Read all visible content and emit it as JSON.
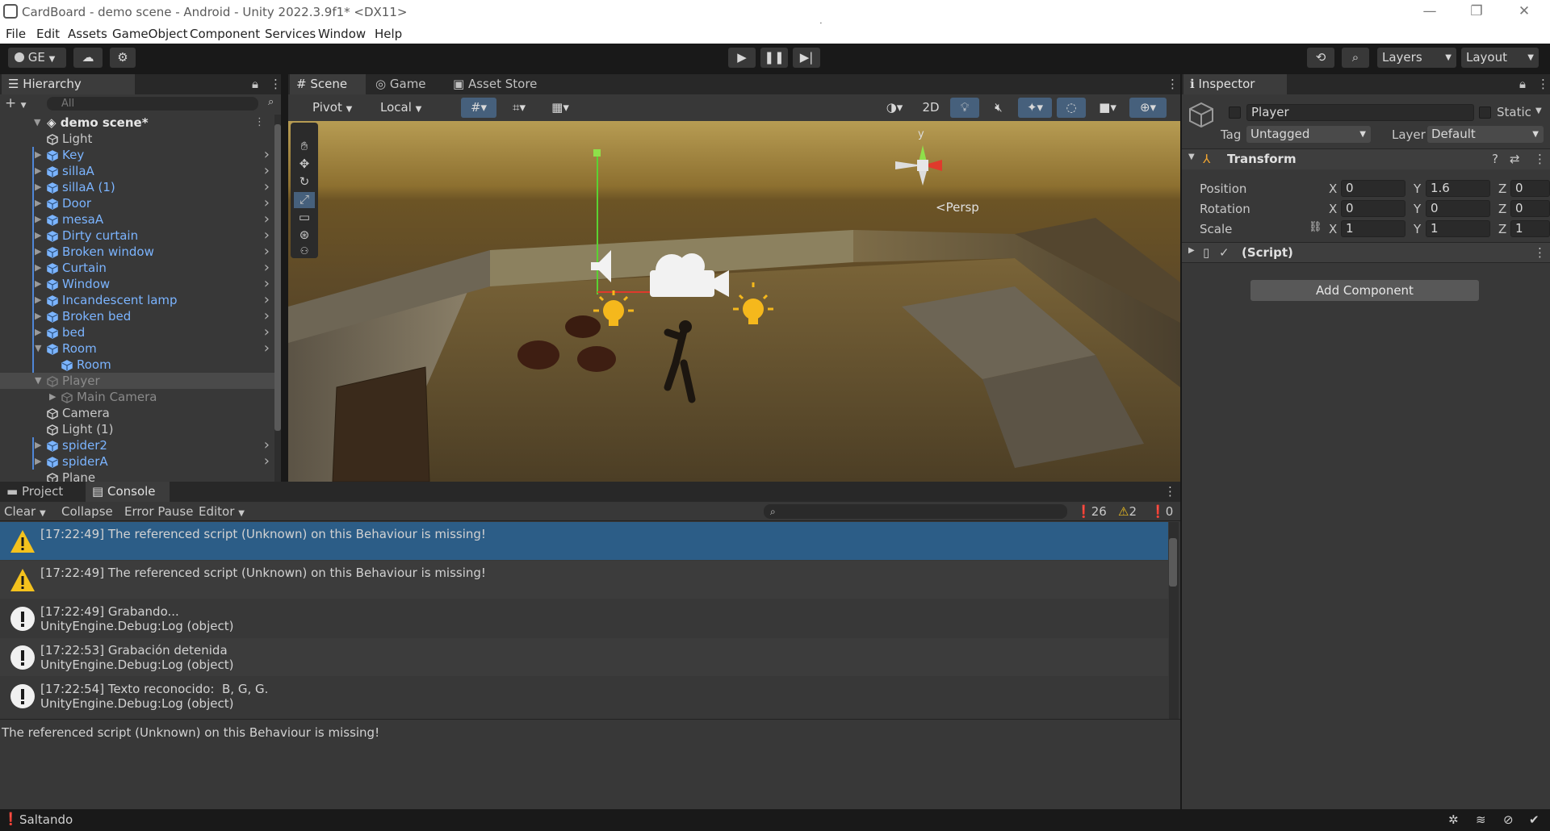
{
  "window": {
    "title": "CardBoard - demo scene - Android - Unity 2022.3.9f1* <DX11>",
    "min": "—",
    "max": "❐",
    "close": "✕"
  },
  "menu": [
    "File",
    "Edit",
    "Assets",
    "GameObject",
    "Component",
    "Services",
    "Window",
    "Help"
  ],
  "toolbar": {
    "account": "GE",
    "layers": "Layers",
    "layout": "Layout"
  },
  "hierarchy": {
    "tab": "Hierarchy",
    "search_placeholder": "All",
    "scene_name": "demo scene*",
    "items": [
      {
        "label": "Light",
        "type": "object",
        "indent": 1,
        "expand": ""
      },
      {
        "label": "Key",
        "type": "prefab",
        "indent": 1,
        "expand": "▶"
      },
      {
        "label": "sillaA",
        "type": "prefab",
        "indent": 1,
        "expand": "▶"
      },
      {
        "label": "sillaA (1)",
        "type": "prefab",
        "indent": 1,
        "expand": "▶"
      },
      {
        "label": "Door",
        "type": "prefab",
        "indent": 1,
        "expand": "▶"
      },
      {
        "label": "mesaA",
        "type": "prefab",
        "indent": 1,
        "expand": "▶"
      },
      {
        "label": "Dirty curtain",
        "type": "prefab",
        "indent": 1,
        "expand": "▶"
      },
      {
        "label": "Broken window",
        "type": "prefab",
        "indent": 1,
        "expand": "▶"
      },
      {
        "label": "Curtain",
        "type": "prefab",
        "indent": 1,
        "expand": "▶"
      },
      {
        "label": "Window",
        "type": "prefab",
        "indent": 1,
        "expand": "▶"
      },
      {
        "label": "Incandescent lamp",
        "type": "prefab",
        "indent": 1,
        "expand": "▶"
      },
      {
        "label": "Broken bed",
        "type": "prefab",
        "indent": 1,
        "expand": "▶"
      },
      {
        "label": "bed",
        "type": "prefab",
        "indent": 1,
        "expand": "▶"
      },
      {
        "label": "Room",
        "type": "prefab",
        "indent": 1,
        "expand": "▼"
      },
      {
        "label": "Room",
        "type": "prefab",
        "indent": 2,
        "expand": ""
      },
      {
        "label": "Player",
        "type": "dim",
        "indent": 1,
        "expand": "▼"
      },
      {
        "label": "Main Camera",
        "type": "dim",
        "indent": 2,
        "expand": "▶"
      },
      {
        "label": "Camera",
        "type": "object",
        "indent": 1,
        "expand": ""
      },
      {
        "label": "Light (1)",
        "type": "object",
        "indent": 1,
        "expand": ""
      },
      {
        "label": "spider2",
        "type": "prefab",
        "indent": 1,
        "expand": "▶"
      },
      {
        "label": "spiderA",
        "type": "prefab",
        "indent": 1,
        "expand": "▶"
      },
      {
        "label": "Plane",
        "type": "object",
        "indent": 1,
        "expand": ""
      }
    ]
  },
  "scene": {
    "tabs": [
      "Scene",
      "Game",
      "Asset Store"
    ],
    "pivot": "Pivot",
    "local": "Local",
    "mode_2d": "2D",
    "persp": "Persp",
    "gizmo_y": "y"
  },
  "console": {
    "tabs": [
      "Project",
      "Console"
    ],
    "clear": "Clear",
    "collapse": "Collapse",
    "error_pause": "Error Pause",
    "editor": "Editor",
    "count_log": "26",
    "count_warn": "2",
    "count_err": "0",
    "rows": [
      {
        "type": "warning",
        "text": "[17:22:49] The referenced script (Unknown) on this Behaviour is missing!",
        "selected": true
      },
      {
        "type": "warning",
        "text": "[17:22:49] The referenced script (Unknown) on this Behaviour is missing!",
        "selected": false
      },
      {
        "type": "info",
        "text": "[17:22:49] Grabando...\nUnityEngine.Debug:Log (object)",
        "selected": false
      },
      {
        "type": "info",
        "text": "[17:22:53] Grabación detenida\nUnityEngine.Debug:Log (object)",
        "selected": false
      },
      {
        "type": "info",
        "text": "[17:22:54] Texto reconocido:  B, G, G.\nUnityEngine.Debug:Log (object)",
        "selected": false
      }
    ],
    "detail": "The referenced script (Unknown) on this Behaviour is missing!"
  },
  "inspector": {
    "tab": "Inspector",
    "object_name": "Player",
    "static_label": "Static",
    "tag_label": "Tag",
    "tag_value": "Untagged",
    "layer_label": "Layer",
    "layer_value": "Default",
    "transform_title": "Transform",
    "position_label": "Position",
    "rotation_label": "Rotation",
    "scale_label": "Scale",
    "position": {
      "x": "0",
      "y": "1.6",
      "z": "0"
    },
    "rotation": {
      "x": "0",
      "y": "0",
      "z": "0"
    },
    "scale": {
      "x": "1",
      "y": "1",
      "z": "1"
    },
    "script_title": "(Script)",
    "add_component": "Add Component",
    "axis_x": "X",
    "axis_y": "Y",
    "axis_z": "Z"
  },
  "status": {
    "text": "Saltando"
  },
  "colors": {
    "accent": "#2c5d87",
    "prefab": "#7bb4ff",
    "panel": "#383838",
    "selected_row": "#2c5d87"
  }
}
